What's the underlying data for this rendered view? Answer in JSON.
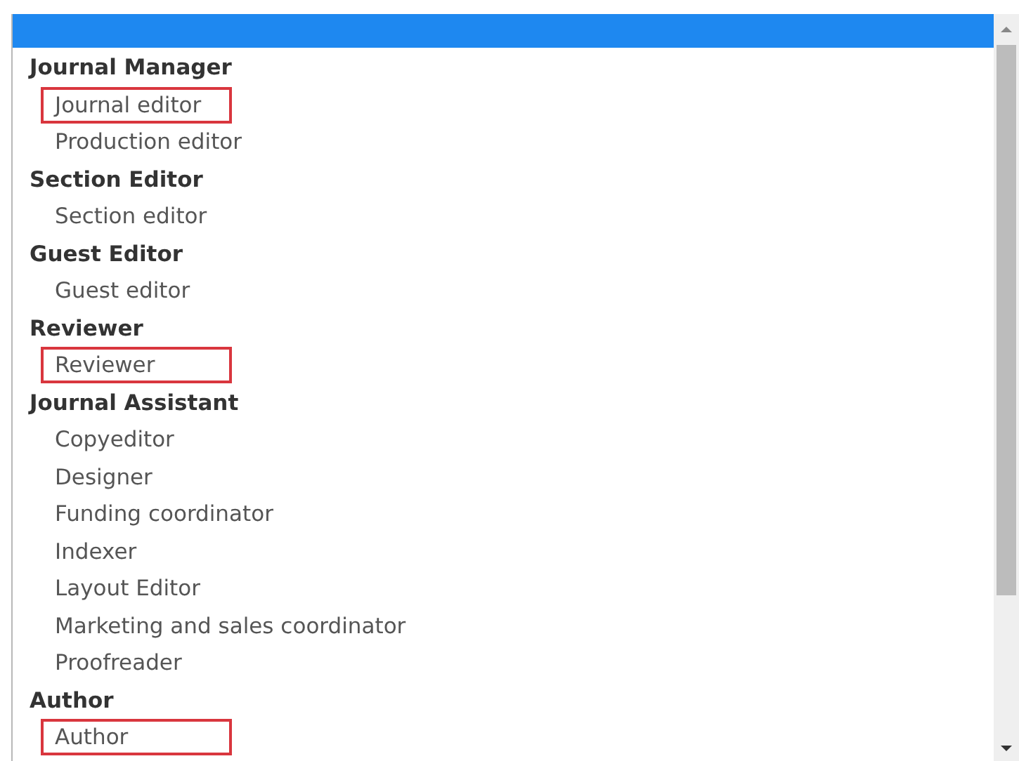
{
  "blank_option": {
    "selected": true
  },
  "groups": [
    {
      "label": "Journal Manager",
      "options": [
        {
          "label": "Journal editor",
          "marked": true
        },
        {
          "label": "Production editor",
          "marked": false
        }
      ]
    },
    {
      "label": "Section Editor",
      "options": [
        {
          "label": "Section editor",
          "marked": false
        }
      ]
    },
    {
      "label": "Guest Editor",
      "options": [
        {
          "label": "Guest editor",
          "marked": false
        }
      ]
    },
    {
      "label": "Reviewer",
      "options": [
        {
          "label": "Reviewer",
          "marked": true
        }
      ]
    },
    {
      "label": "Journal Assistant",
      "options": [
        {
          "label": "Copyeditor",
          "marked": false
        },
        {
          "label": "Designer",
          "marked": false
        },
        {
          "label": "Funding coordinator",
          "marked": false
        },
        {
          "label": "Indexer",
          "marked": false
        },
        {
          "label": "Layout Editor",
          "marked": false
        },
        {
          "label": "Marketing and sales coordinator",
          "marked": false
        },
        {
          "label": "Proofreader",
          "marked": false
        }
      ]
    },
    {
      "label": "Author",
      "options": [
        {
          "label": "Author",
          "marked": true
        }
      ]
    }
  ]
}
